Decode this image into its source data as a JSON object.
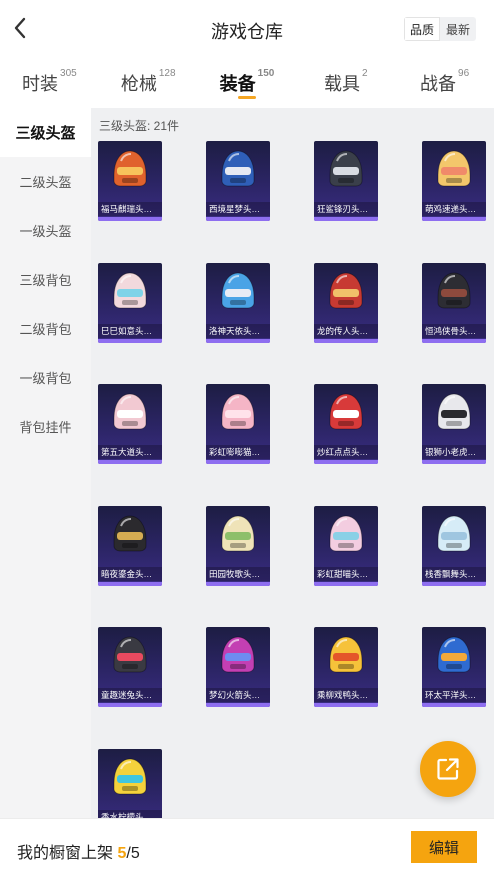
{
  "header": {
    "title": "游戏仓库",
    "back_icon": "chevron-left-icon",
    "sort_options": [
      "品质",
      "最新"
    ],
    "sort_selected": "品质"
  },
  "tabs": [
    {
      "label": "时装",
      "count": "305",
      "active": false
    },
    {
      "label": "枪械",
      "count": "128",
      "active": false
    },
    {
      "label": "装备",
      "count": "150",
      "active": true
    },
    {
      "label": "载具",
      "count": "2",
      "active": false
    },
    {
      "label": "战备",
      "count": "96",
      "active": false
    }
  ],
  "sidebar": {
    "items": [
      {
        "label": "三级头盔",
        "active": true
      },
      {
        "label": "二级头盔",
        "active": false
      },
      {
        "label": "一级头盔",
        "active": false
      },
      {
        "label": "三级背包",
        "active": false
      },
      {
        "label": "二级背包",
        "active": false
      },
      {
        "label": "一级背包",
        "active": false
      },
      {
        "label": "背包挂件",
        "active": false
      }
    ]
  },
  "main": {
    "count_label": "三级头盔: 21件",
    "items": [
      {
        "name": "福马麒瑞头盔...",
        "color": "#e0622d",
        "accent": "#f7c35b"
      },
      {
        "name": "西境星梦头盔...",
        "color": "#2f5fb8",
        "accent": "#e6e9f2"
      },
      {
        "name": "狂鲨锋刃头盔...",
        "color": "#3a3f4a",
        "accent": "#d8dce3"
      },
      {
        "name": "萌鸡速递头盔...",
        "color": "#f3c76b",
        "accent": "#f08a6a"
      },
      {
        "name": "巳巳如意头盔...",
        "color": "#f2d9dd",
        "accent": "#7fd3e8"
      },
      {
        "name": "洛神天依头盔...",
        "color": "#4aa3e6",
        "accent": "#e9ecf5"
      },
      {
        "name": "龙的传人头盔...",
        "color": "#c73a32",
        "accent": "#f1c16a"
      },
      {
        "name": "恒鸿侠骨头盔...",
        "color": "#2d2d33",
        "accent": "#8d4a3d"
      },
      {
        "name": "第五大道头盔...",
        "color": "#f2c9d2",
        "accent": "#ffffff"
      },
      {
        "name": "彩虹嘭嘭猫头...",
        "color": "#f5b5c6",
        "accent": "#ffe3ea"
      },
      {
        "name": "炒红点点头盔...",
        "color": "#d83a3a",
        "accent": "#ffffff"
      },
      {
        "name": "银狮小老虎头...",
        "color": "#e8e8ec",
        "accent": "#2a2a2e"
      },
      {
        "name": "暗夜鎏金头盔...",
        "color": "#2b2a2e",
        "accent": "#d6ad52"
      },
      {
        "name": "田园牧歌头盔...",
        "color": "#efe3b8",
        "accent": "#8dbf6a"
      },
      {
        "name": "彩虹甜喵头盔...",
        "color": "#f3cde0",
        "accent": "#8ad0e6"
      },
      {
        "name": "栈香飘舞头盔...",
        "color": "#d6ecf7",
        "accent": "#9fc6e0"
      },
      {
        "name": "童趣迷兔头盔...",
        "color": "#3a3a42",
        "accent": "#e84a5f"
      },
      {
        "name": "梦幻火箭头盔...",
        "color": "#c33fb3",
        "accent": "#6e8cf0"
      },
      {
        "name": "乘柳戏鸭头盔...",
        "color": "#f6c23a",
        "accent": "#e4552a"
      },
      {
        "name": "环太平洋头盔...",
        "color": "#2f6bd1",
        "accent": "#f2a93a"
      },
      {
        "name": "香水柠檬头盔...",
        "color": "#f4d23c",
        "accent": "#3fc6e0"
      }
    ]
  },
  "fab": {
    "icon": "share-external-icon"
  },
  "bottom": {
    "label": "我的橱窗上架",
    "current": "5",
    "total": "/5",
    "edit_label": "编辑"
  }
}
